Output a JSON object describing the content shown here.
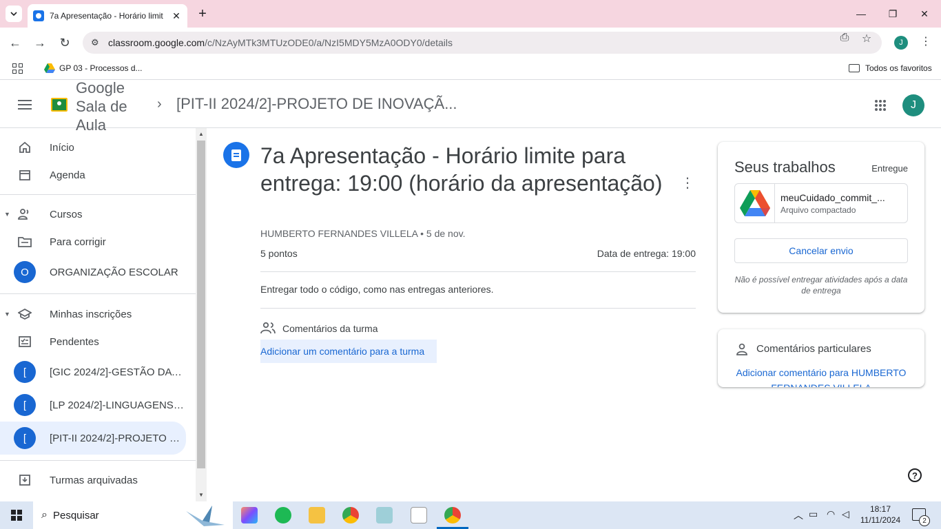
{
  "browser": {
    "tab_title": "7a Apresentação - Horário limit",
    "new_tab": "+",
    "url_domain": "classroom.google.com",
    "url_path": "/c/NzAyMTk3MTUzODE0/a/NzI5MDY5MzA0ODY0/details",
    "profile_initial": "J",
    "bookmark_1": "GP 03 - Processos d...",
    "all_bookmarks": "Todos os favoritos"
  },
  "header": {
    "brand": "Google Sala de Aula",
    "breadcrumb": "[PIT-II 2024/2]-PROJETO DE INOVAÇÃ...",
    "avatar_initial": "J"
  },
  "sidebar": {
    "home": "Início",
    "calendar": "Agenda",
    "courses": "Cursos",
    "to_review": "Para corrigir",
    "org_initial": "O",
    "org_label": "ORGANIZAÇÃO ESCOLAR",
    "enrolled": "Minhas inscrições",
    "todo": "Pendentes",
    "class_initial": "[",
    "class_1": "[GIC 2024/2]-GESTÃO DA I...",
    "class_2": "[LP 2024/2]-LINGUAGENS ...",
    "class_3": "[PIT-II 2024/2]-PROJETO D...",
    "archived": "Turmas arquivadas"
  },
  "assignment": {
    "title": "7a Apresentação - Horário limite para entrega: 19:00 (horário da apresentação)",
    "author_date": "HUMBERTO FERNANDES VILLELA • 5 de nov.",
    "points": "5 pontos",
    "due": "Data de entrega: 19:00",
    "description": "Entregar todo o código, como nas entregas anteriores.",
    "class_comments_title": "Comentários da turma",
    "add_class_comment": "Adicionar um comentário para a turma"
  },
  "your_work": {
    "heading": "Seus trabalhos",
    "status": "Entregue",
    "file_name": "meuCuidado_commit_...",
    "file_type": "Arquivo compactado",
    "unsubmit": "Cancelar envio",
    "note": "Não é possível entregar atividades após a data de entrega"
  },
  "private_comments": {
    "heading": "Comentários particulares",
    "add_link": "Adicionar comentário para HUMBERTO FERNANDES VILLELA"
  },
  "taskbar": {
    "search": "Pesquisar",
    "time": "18:17",
    "date": "11/11/2024",
    "notif_count": "2"
  },
  "icons": [
    "tab-list-icon",
    "classroom-favicon",
    "close-icon",
    "back-icon",
    "forward-icon",
    "reload-icon",
    "site-settings-icon",
    "install-icon",
    "star-icon",
    "drive-icon",
    "folder-icon",
    "menu-icon",
    "apps-grid-icon",
    "home-icon",
    "calendar-icon",
    "people-icon",
    "review-icon",
    "school-icon",
    "todo-icon",
    "archive-icon",
    "assignment-icon",
    "more-vert-icon",
    "help-icon",
    "windows-icon",
    "search-icon"
  ]
}
